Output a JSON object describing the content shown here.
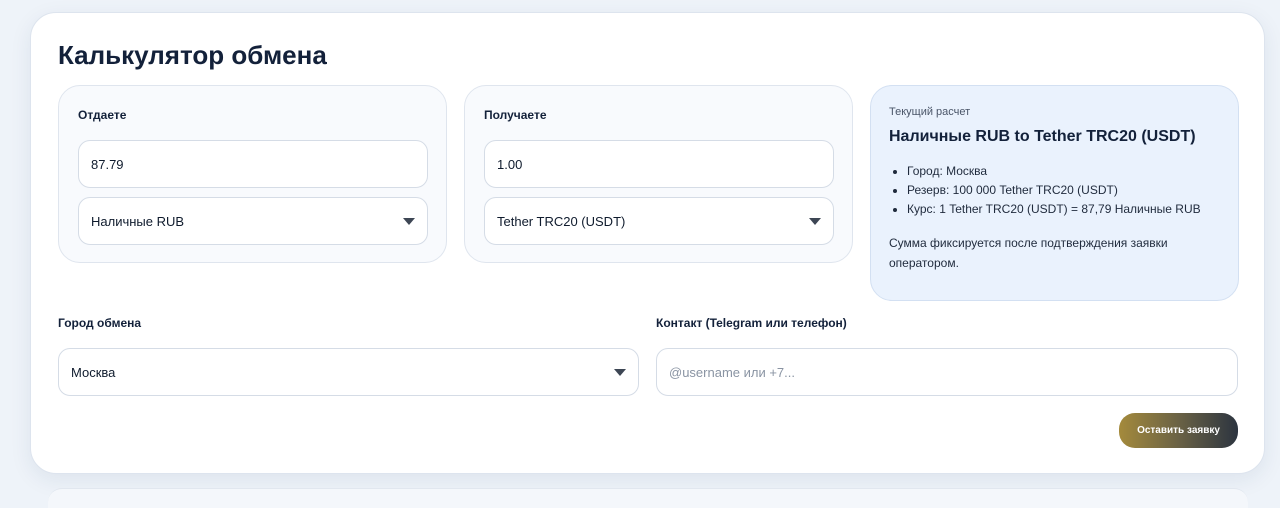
{
  "calculator": {
    "title": "Калькулятор обмена",
    "give": {
      "label": "Отдаете",
      "amount": "87.79",
      "currency": "Наличные RUB"
    },
    "get": {
      "label": "Получаете",
      "amount": "1.00",
      "currency": "Tether TRC20 (USDT)"
    },
    "summary": {
      "caption": "Текущий расчет",
      "title": "Наличные RUB to Tether TRC20 (USDT)",
      "items": [
        "Город: Москва",
        "Резерв: 100 000 Tether TRC20 (USDT)",
        "Курс: 1 Tether TRC20 (USDT) = 87,79 Наличные RUB"
      ],
      "note": "Сумма фиксируется после подтверждения заявки оператором."
    },
    "city": {
      "label": "Город обмена",
      "value": "Москва"
    },
    "contact": {
      "label": "Контакт (Telegram или телефон)",
      "placeholder": "@username или +7..."
    },
    "submit_label": "Оставить заявку"
  },
  "colors": {
    "accent_gold": "#a48a3c",
    "summary_bg": "#eaf2fd",
    "text_dark": "#13213a"
  },
  "icons": {
    "select_caret": "chevron-down-icon"
  }
}
